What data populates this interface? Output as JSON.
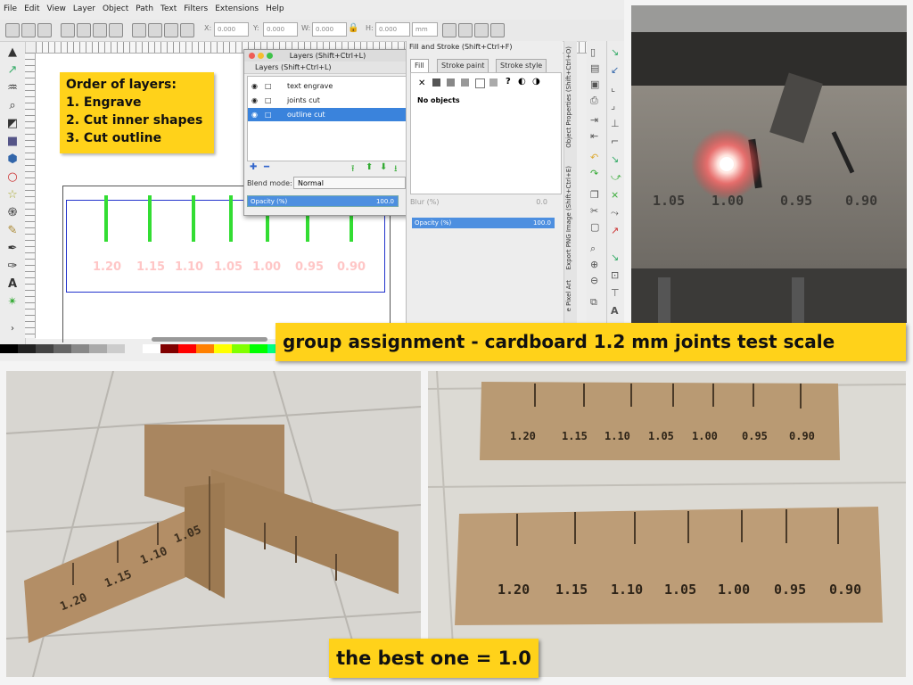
{
  "menubar": {
    "items": [
      "File",
      "Edit",
      "View",
      "Layer",
      "Object",
      "Path",
      "Text",
      "Filters",
      "Extensions",
      "Help"
    ]
  },
  "toolbar": {
    "x_label": "X:",
    "x_value": "0.000",
    "y_label": "Y:",
    "y_value": "0.000",
    "w_label": "W:",
    "w_value": "0.000",
    "h_label": "H:",
    "h_value": "0.000",
    "unit": "mm"
  },
  "note": {
    "title": "Order of layers:",
    "step1": "1. Engrave",
    "step2": "2. Cut inner shapes",
    "step3": "3. Cut outline"
  },
  "canvas": {
    "scale_numbers": [
      "1.20",
      "1.15",
      "1.10",
      "1.05",
      "1.00",
      "0.95",
      "0.90"
    ]
  },
  "layers_dialog": {
    "window_title": "Layers (Shift+Ctrl+L)",
    "panel_title": "Layers (Shift+Ctrl+L)",
    "layers": [
      {
        "label": "text engrave",
        "selected": false
      },
      {
        "label": "joints cut",
        "selected": false
      },
      {
        "label": "outline cut",
        "selected": true
      }
    ],
    "blend_label": "Blend mode:",
    "blend_value": "Normal",
    "opacity_label": "Opacity (%)",
    "opacity_value": "100.0"
  },
  "fill_stroke": {
    "title": "Fill and Stroke (Shift+Ctrl+F)",
    "tabs": [
      "Fill",
      "Stroke paint",
      "Stroke style"
    ],
    "status": "No objects",
    "blur_label": "Blur (%)",
    "blur_value": "0.0",
    "opacity_label": "Opacity (%)",
    "opacity_value": "100.0"
  },
  "side_tabs": [
    "Object Properties (Shift+Ctrl+O)",
    "Export PNG Image (Shift+Ctrl+E)",
    "e Pixel Art"
  ],
  "photo_laser": {
    "labels": [
      "1.05",
      "1.00",
      "0.95",
      "0.90"
    ]
  },
  "photo_cross": {
    "labels": [
      "1.20",
      "1.15",
      "1.10",
      "1.05"
    ]
  },
  "photo_strips": {
    "labels": [
      "1.20",
      "1.15",
      "1.10",
      "1.05",
      "1.00",
      "0.95",
      "0.90"
    ]
  },
  "banners": {
    "main": "group  assignment  - cardboard 1.2 mm joints test scale",
    "best": "the best one = 1.0"
  },
  "colors": {
    "highlight": "#ffd21a",
    "selection": "#3a83dc",
    "slot_green": "#33dd33",
    "outline_blue": "#2233cc"
  }
}
